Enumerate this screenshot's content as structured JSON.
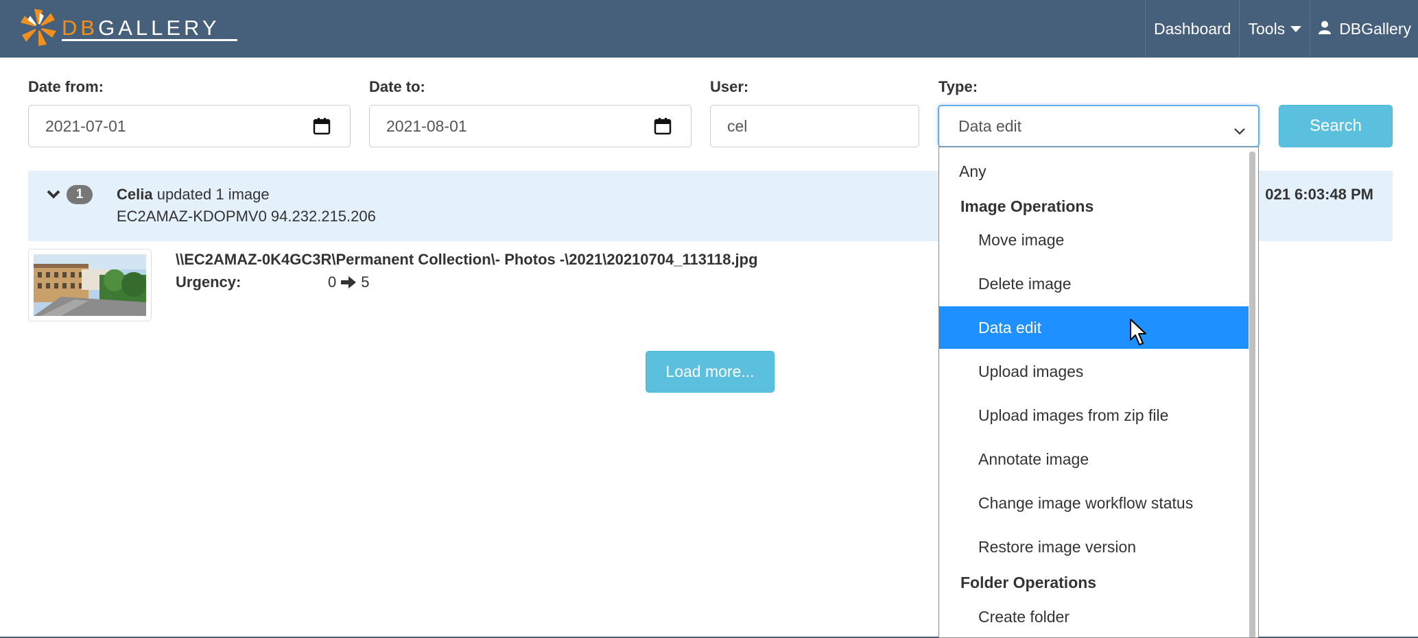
{
  "app": {
    "brand_db": "DB",
    "brand_gallery": "Gallery"
  },
  "nav": {
    "dashboard": "Dashboard",
    "tools": "Tools",
    "user": "DBGallery"
  },
  "filters": {
    "date_from_label": "Date from:",
    "date_from_value": "2021-07-01",
    "date_to_label": "Date to:",
    "date_to_value": "2021-08-01",
    "user_label": "User:",
    "user_value": "cel",
    "type_label": "Type:",
    "type_value": "Data edit",
    "search_label": "Search"
  },
  "activity": {
    "count": "1",
    "user_name": "Celia",
    "action": " updated 1 image",
    "host_ip": "EC2AMAZ-KDOPMV0 94.232.215.206",
    "timestamp": "021 6:03:48 PM",
    "image_path": "\\\\EC2AMAZ-0K4GC3R\\Permanent Collection\\- Photos -\\2021\\20210704_113118.jpg",
    "field_label": "Urgency:",
    "old_value": "0",
    "new_value": "5"
  },
  "load_more": "Load more...",
  "type_dropdown": {
    "any": "Any",
    "groups": [
      {
        "label": "Image Operations",
        "items": [
          "Move image",
          "Delete image",
          "Data edit",
          "Upload images",
          "Upload images from zip file",
          "Annotate image",
          "Change image workflow status",
          "Restore image version"
        ]
      },
      {
        "label": "Folder Operations",
        "items": [
          "Create folder"
        ]
      }
    ],
    "selected": "Data edit"
  },
  "colors": {
    "navbar": "#465f7a",
    "accent_orange": "#f0901e",
    "button_info": "#5bc0de",
    "selected_option": "#1e90ff",
    "activity_bg": "#e4f0fa"
  }
}
